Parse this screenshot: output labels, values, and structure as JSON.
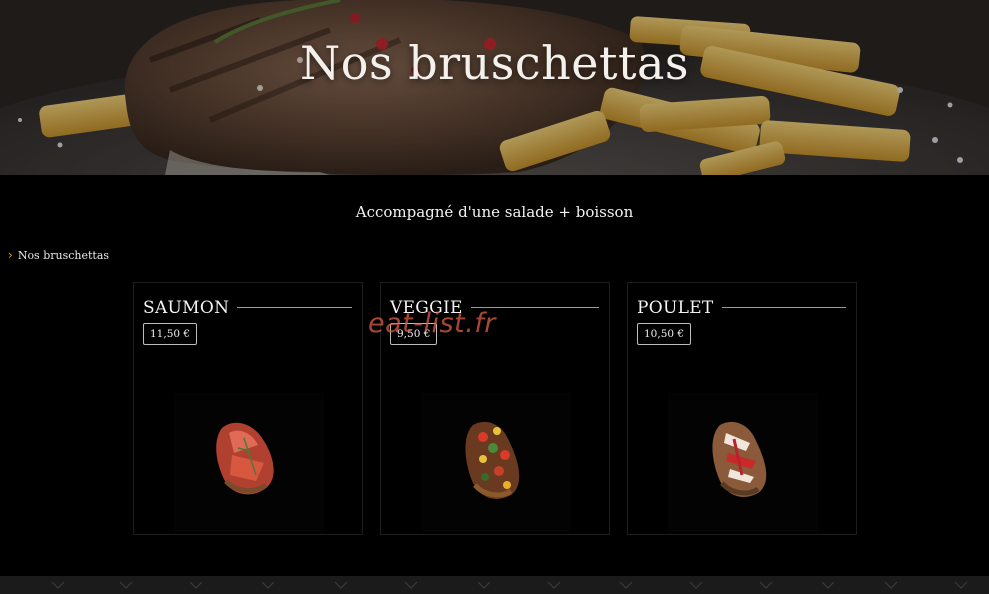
{
  "hero": {
    "title": "Nos bruschettas",
    "image_icon": "steak-fries-photo"
  },
  "section": {
    "subtitle": "Accompagné d'une salade + boisson"
  },
  "breadcrumb": {
    "icon": "chevron-right-icon",
    "label": "Nos bruschettas"
  },
  "watermark": "eat-list.fr",
  "products": [
    {
      "name": "SAUMON",
      "price": "11,50 €",
      "image_icon": "salmon-bruschetta-photo"
    },
    {
      "name": "VEGGIE",
      "price": "9,50 €",
      "image_icon": "veggie-bruschetta-photo"
    },
    {
      "name": "POULET",
      "price": "10,50 €",
      "image_icon": "chicken-bruschetta-photo"
    }
  ],
  "colors": {
    "background": "#000000",
    "accent": "#e59a2c",
    "watermark": "#dc5f46"
  }
}
